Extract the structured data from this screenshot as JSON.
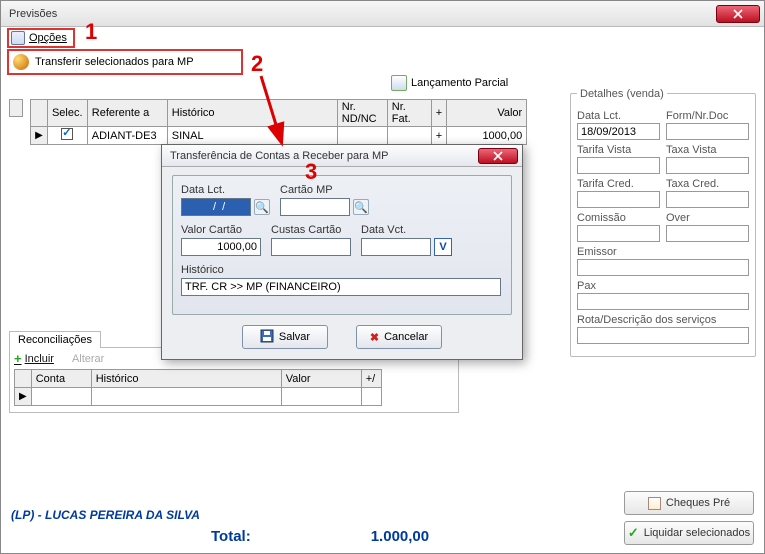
{
  "window": {
    "title": "Previsões"
  },
  "toolbar": {
    "opcoes_label": "Opções",
    "transferir_label": "Transferir selecionados para MP",
    "lancamento_label": "Lançamento Parcial"
  },
  "grid": {
    "headers": {
      "selec": "Selec.",
      "referente": "Referente a",
      "historico": "Histórico",
      "ndnc": "Nr. ND/NC",
      "nrfat": "Nr. Fat.",
      "plus": "+",
      "valor": "Valor"
    },
    "rows": [
      {
        "selected": true,
        "referente": "ADIANT-DE3",
        "historico": "SINAL",
        "ndnc": "",
        "nrfat": "",
        "plus": "+",
        "valor": "1000,00"
      }
    ]
  },
  "detalhes": {
    "title": "Detalhes (venda)",
    "data_lct_label": "Data Lct.",
    "data_lct_value": "18/09/2013",
    "form_label": "Form/Nr.Doc",
    "form_value": "",
    "tarifa_vista_label": "Tarifa Vista",
    "tarifa_vista_value": "",
    "taxa_vista_label": "Taxa Vista",
    "taxa_vista_value": "",
    "tarifa_cred_label": "Tarifa Cred.",
    "tarifa_cred_value": "",
    "taxa_cred_label": "Taxa Cred.",
    "taxa_cred_value": "",
    "comissao_label": "Comissão",
    "comissao_value": "",
    "over_label": "Over",
    "over_value": "",
    "emissor_label": "Emissor",
    "emissor_value": "",
    "pax_label": "Pax",
    "pax_value": "",
    "rota_label": "Rota/Descrição dos serviços",
    "rota_value": ""
  },
  "recon": {
    "title": "Reconciliações",
    "incluir_label": "Incluir",
    "alterar_label": "Alterar",
    "headers": {
      "conta": "Conta",
      "historico": "Histórico",
      "valor": "Valor",
      "plus": "+/"
    }
  },
  "footer": {
    "name": "(LP) - LUCAS PEREIRA DA SILVA",
    "total_label": "Total:",
    "total_value": "1.000,00",
    "cheques_label": "Cheques Pré",
    "liquidar_label": "Liquidar selecionados"
  },
  "modal": {
    "title": "Transferência de Contas a Receber para MP",
    "data_lct_label": "Data Lct.",
    "data_lct_value": "  /  /",
    "cartao_label": "Cartão MP",
    "cartao_value": "",
    "valor_cartao_label": "Valor Cartão",
    "valor_cartao_value": "1000,00",
    "custas_label": "Custas Cartão",
    "custas_value": "",
    "data_vct_label": "Data Vct.",
    "data_vct_value": "",
    "v_label": "V",
    "historico_label": "Histórico",
    "historico_value": "TRF. CR >> MP (FINANCEIRO)",
    "salvar_label": "Salvar",
    "cancelar_label": "Cancelar"
  },
  "annotations": {
    "a1": "1",
    "a2": "2",
    "a3": "3"
  }
}
